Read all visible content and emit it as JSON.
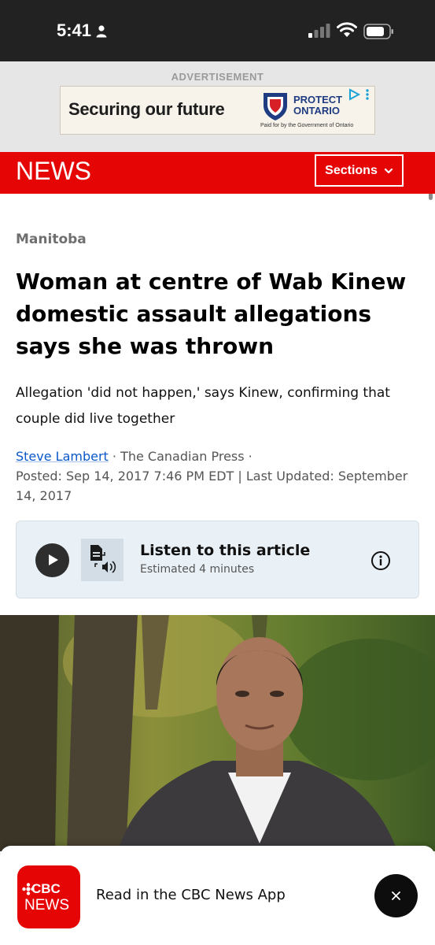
{
  "status_bar": {
    "time": "5:41"
  },
  "ad": {
    "label": "ADVERTISEMENT",
    "headline": "Securing our future",
    "brand_line1": "PROTECT",
    "brand_line2": "ONTARIO",
    "paid_by": "Paid for by the Government of Ontario"
  },
  "header": {
    "logo": "NEWS",
    "sections_label": "Sections"
  },
  "article": {
    "section": "Manitoba",
    "headline": "Woman at centre of Wab Kinew domestic assault allegations says she was thrown",
    "deck": "Allegation 'did not happen,' says Kinew, confirming that couple did live together",
    "author": "Steve Lambert",
    "source": " · The Canadian Press ·",
    "dates": "Posted: Sep 14, 2017 7:46 PM EDT | Last Updated: September 14, 2017"
  },
  "listen": {
    "title": "Listen to this article",
    "estimate": "Estimated 4 minutes"
  },
  "app_banner": {
    "icon_top": "CBC",
    "icon_bottom": "NEWS",
    "text": "Read in the CBC News App"
  },
  "colors": {
    "brand_red": "#e60505",
    "link_blue": "#0a58ca",
    "listen_bg": "#eaf1f6"
  },
  "icons": [
    "person-icon",
    "signal-icon",
    "wifi-icon",
    "battery-icon",
    "ad-choices-icon",
    "chevron-down-icon",
    "play-icon",
    "text-to-speech-icon",
    "info-icon",
    "close-icon"
  ]
}
